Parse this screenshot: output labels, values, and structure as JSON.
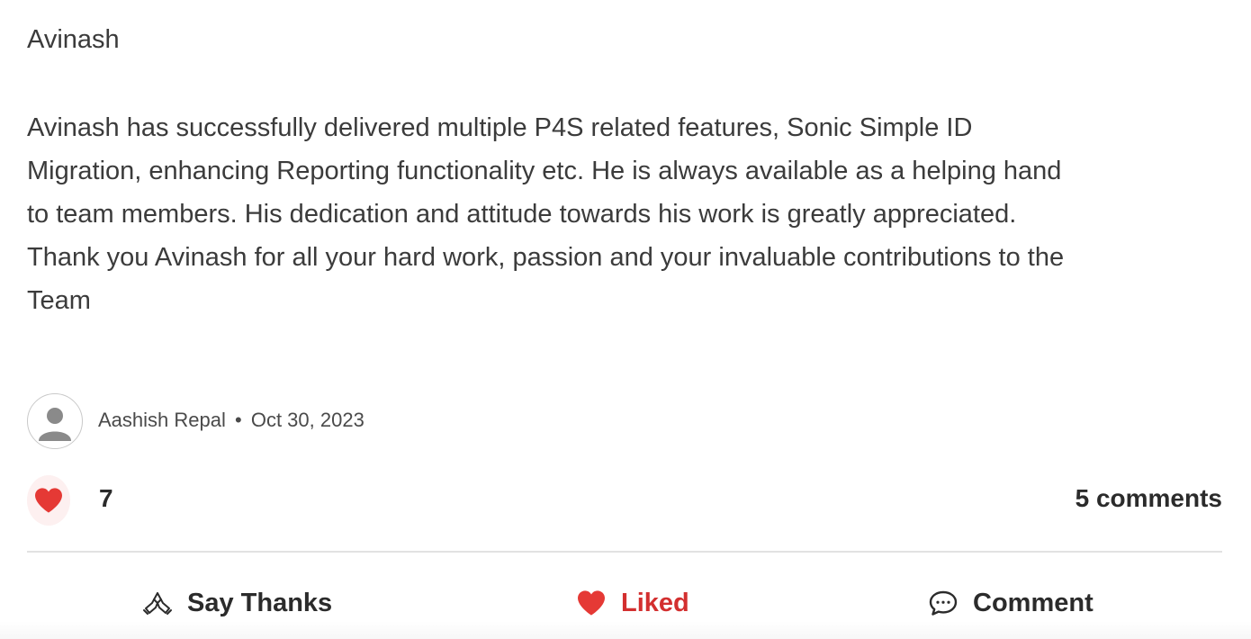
{
  "post": {
    "recipient": "Avinash",
    "message_lines": [
      "Avinash has successfully delivered multiple P4S related features, Sonic Simple ID",
      "Migration, enhancing Reporting functionality etc. He is always available as a helping hand",
      "to team members. His dedication and attitude towards his work is greatly appreciated.",
      "Thank you Avinash for all your hard work, passion and your invaluable contributions to the",
      "Team"
    ],
    "author": "Aashish Repal",
    "separator": "•",
    "date": "Oct 30, 2023",
    "avatar_icon": "default-user-avatar-icon"
  },
  "stats": {
    "like_count": "7",
    "comments_label": "5 comments",
    "like_icon": "heart-icon"
  },
  "actions": {
    "say_thanks_label": "Say Thanks",
    "say_thanks_icon": "praying-hands-icon",
    "liked_label": "Liked",
    "liked_icon": "heart-icon",
    "comment_label": "Comment",
    "comment_icon": "speech-bubble-icon"
  },
  "colors": {
    "text": "#3b3b3b",
    "heart": "#e53935",
    "liked_text": "#d32f2f",
    "like_bg": "#fdf0f0",
    "divider": "#e2e2e2"
  }
}
